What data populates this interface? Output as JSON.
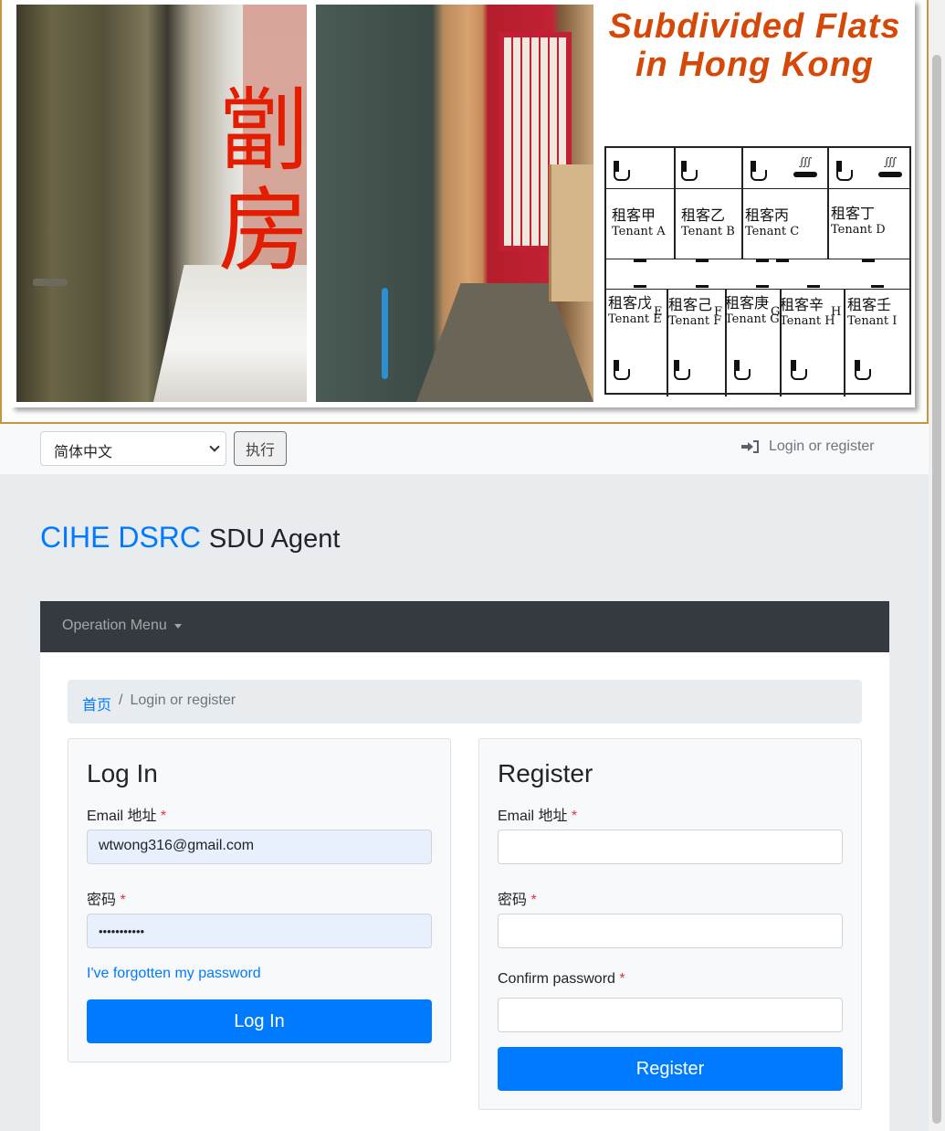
{
  "banner": {
    "chars": [
      "劏",
      "房"
    ],
    "title_line1": "Subdivided Flats",
    "title_line2": "in Hong Kong",
    "tenants_top": [
      {
        "zh": "租客甲",
        "en": "Tenant A"
      },
      {
        "zh": "租客乙",
        "en": "Tenant B"
      },
      {
        "zh": "租客丙",
        "en": "Tenant C"
      },
      {
        "zh": "租客丁",
        "en": "Tenant D"
      }
    ],
    "tenants_bottom": [
      {
        "zh": "租客戊",
        "en": "Tenant E",
        "mark": "E"
      },
      {
        "zh": "租客己",
        "en": "Tenant F",
        "mark": "F"
      },
      {
        "zh": "租客庚",
        "en": "Tenant G",
        "mark": "G"
      },
      {
        "zh": "租客辛",
        "en": "Tenant H",
        "mark": "H"
      },
      {
        "zh": "租客壬",
        "en": "Tenant I",
        "mark": ""
      }
    ]
  },
  "topnav": {
    "language_value": "简体中文",
    "execute_label": "执行",
    "login_link": "Login or register"
  },
  "brand": {
    "part1": "CIHE DSRC",
    "part2": "SDU Agent"
  },
  "menu": {
    "operation_menu": "Operation Menu"
  },
  "breadcrumb": {
    "home": "首页",
    "separator": "/",
    "current": "Login or register"
  },
  "login": {
    "heading": "Log In",
    "email_label": "Email 地址",
    "email_value": "wtwong316@gmail.com",
    "password_label": "密码",
    "password_value": "•••••••••••",
    "forgot_link": "I've forgotten my password",
    "submit_label": "Log In",
    "required_mark": "*"
  },
  "register": {
    "heading": "Register",
    "email_label": "Email 地址",
    "password_label": "密码",
    "confirm_label": "Confirm password",
    "submit_label": "Register",
    "required_mark": "*"
  },
  "colors": {
    "primary": "#007bff",
    "navbar_dark": "#343a40",
    "banner_title": "#d54807",
    "banner_chars": "#e21d02",
    "required": "#dc3545"
  }
}
